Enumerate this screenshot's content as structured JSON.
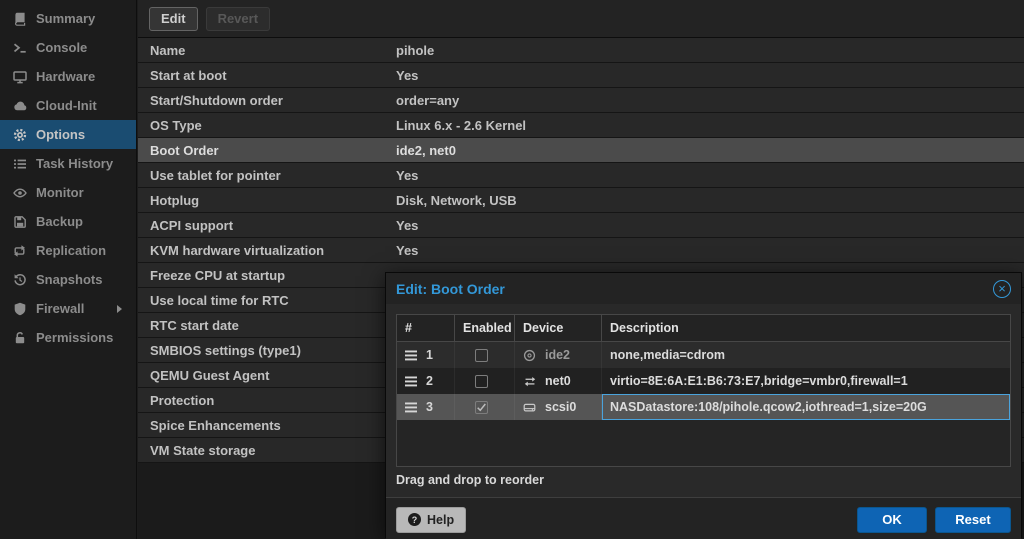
{
  "sidebar": {
    "items": [
      {
        "label": "Summary",
        "icon": "book-icon",
        "selected": false
      },
      {
        "label": "Console",
        "icon": "terminal-icon",
        "selected": false
      },
      {
        "label": "Hardware",
        "icon": "display-icon",
        "selected": false
      },
      {
        "label": "Cloud-Init",
        "icon": "cloud-icon",
        "selected": false
      },
      {
        "label": "Options",
        "icon": "gear-icon",
        "selected": true
      },
      {
        "label": "Task History",
        "icon": "list-icon",
        "selected": false
      },
      {
        "label": "Monitor",
        "icon": "eye-icon",
        "selected": false
      },
      {
        "label": "Backup",
        "icon": "floppy-icon",
        "selected": false
      },
      {
        "label": "Replication",
        "icon": "retweet-icon",
        "selected": false
      },
      {
        "label": "Snapshots",
        "icon": "history-icon",
        "selected": false
      },
      {
        "label": "Firewall",
        "icon": "shield-icon",
        "selected": false,
        "has_submenu": true
      },
      {
        "label": "Permissions",
        "icon": "unlock-icon",
        "selected": false
      }
    ]
  },
  "toolbar": {
    "edit_label": "Edit",
    "revert_label": "Revert"
  },
  "options_table": {
    "rows": [
      {
        "label": "Name",
        "value": "pihole"
      },
      {
        "label": "Start at boot",
        "value": "Yes"
      },
      {
        "label": "Start/Shutdown order",
        "value": "order=any"
      },
      {
        "label": "OS Type",
        "value": "Linux 6.x - 2.6 Kernel"
      },
      {
        "label": "Boot Order",
        "value": "ide2, net0",
        "selected": true
      },
      {
        "label": "Use tablet for pointer",
        "value": "Yes"
      },
      {
        "label": "Hotplug",
        "value": "Disk, Network, USB"
      },
      {
        "label": "ACPI support",
        "value": "Yes"
      },
      {
        "label": "KVM hardware virtualization",
        "value": "Yes"
      },
      {
        "label": "Freeze CPU at startup",
        "value": ""
      },
      {
        "label": "Use local time for RTC",
        "value": ""
      },
      {
        "label": "RTC start date",
        "value": ""
      },
      {
        "label": "SMBIOS settings (type1)",
        "value": ""
      },
      {
        "label": "QEMU Guest Agent",
        "value": ""
      },
      {
        "label": "Protection",
        "value": ""
      },
      {
        "label": "Spice Enhancements",
        "value": ""
      },
      {
        "label": "VM State storage",
        "value": ""
      }
    ]
  },
  "dialog": {
    "title": "Edit: Boot Order",
    "columns": [
      "#",
      "Enabled",
      "Device",
      "Description"
    ],
    "rows": [
      {
        "order": "1",
        "enabled": false,
        "device": "ide2",
        "device_icon": "cdrom-icon",
        "description": "none,media=cdrom",
        "selected": false
      },
      {
        "order": "2",
        "enabled": false,
        "device": "net0",
        "device_icon": "network-icon",
        "description": "virtio=8E:6A:E1:B6:73:E7,bridge=vmbr0,firewall=1",
        "selected": false
      },
      {
        "order": "3",
        "enabled": true,
        "device": "scsi0",
        "device_icon": "hdd-icon",
        "description": "NASDatastore:108/pihole.qcow2,iothread=1,size=20G",
        "selected": true
      }
    ],
    "hint": "Drag and drop to reorder",
    "help_label": "Help",
    "ok_label": "OK",
    "reset_label": "Reset",
    "close_glyph": "×"
  },
  "colors": {
    "accent_blue": "#3398d8",
    "button_blue": "#0e64b4",
    "selected_nav_bg": "#1a4c71",
    "selected_row_bg": "#4b4b4b",
    "focus_border": "#4aa3dc"
  }
}
